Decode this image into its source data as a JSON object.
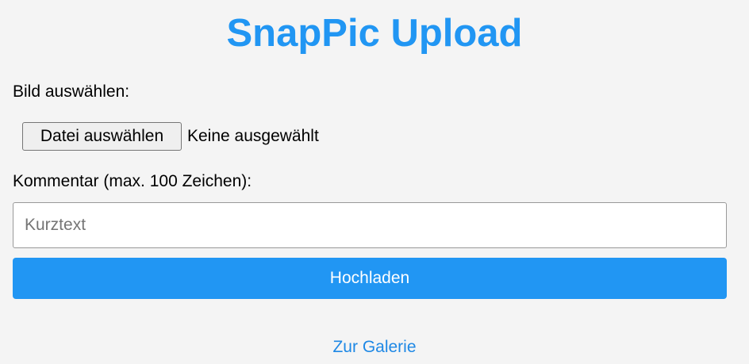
{
  "title": "SnapPic Upload",
  "image_label": "Bild auswählen:",
  "file_button": "Datei auswählen",
  "file_status": "Keine ausgewählt",
  "comment_label": "Kommentar (max. 100 Zeichen):",
  "comment_placeholder": "Kurztext",
  "comment_value": "",
  "submit_label": "Hochladen",
  "gallery_link": "Zur Galerie",
  "accent_color": "#2196f3"
}
